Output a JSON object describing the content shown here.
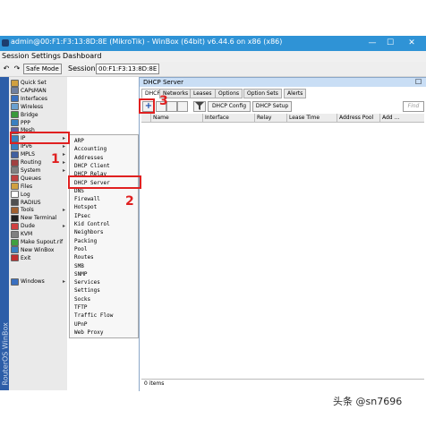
{
  "titlebar": {
    "title": "admin@00:F1:F3:13:8D:8E (MikroTik) - WinBox (64bit) v6.44.6 on x86 (x86)",
    "minimize": "—",
    "maximize": "☐",
    "close": "✕"
  },
  "menubar": {
    "items": [
      "Session",
      "Settings",
      "Dashboard"
    ]
  },
  "toolbar": {
    "back": "↶",
    "forward": "↷",
    "safe_mode_label": "Safe Mode",
    "session_label": "Session:",
    "session_value": "00:F1:F3:13:8D:8E"
  },
  "sidebar": {
    "brand": "RouterOS WinBox",
    "items": [
      {
        "label": "Quick Set",
        "color": "#d0a040"
      },
      {
        "label": "CAPsMAN",
        "color": "#7080a0"
      },
      {
        "label": "Interfaces",
        "color": "#3a70c0"
      },
      {
        "label": "Wireless",
        "color": "#6aa0d0"
      },
      {
        "label": "Bridge",
        "color": "#3a9a3a"
      },
      {
        "label": "PPP",
        "color": "#3a80c0"
      },
      {
        "label": "Mesh",
        "color": "#6060a0"
      },
      {
        "label": "IP",
        "color": "#3a80c0",
        "arrow": "▸"
      },
      {
        "label": "IPv6",
        "color": "#3a80c0",
        "arrow": "▸"
      },
      {
        "label": "MPLS",
        "color": "#4060a0",
        "arrow": "▸"
      },
      {
        "label": "Routing",
        "color": "#a04040",
        "arrow": "▸"
      },
      {
        "label": "System",
        "color": "#808080",
        "arrow": "▸"
      },
      {
        "label": "Queues",
        "color": "#c04040"
      },
      {
        "label": "Files",
        "color": "#d0a040"
      },
      {
        "label": "Log",
        "color": "#ffffff"
      },
      {
        "label": "RADIUS",
        "color": "#505050"
      },
      {
        "label": "Tools",
        "color": "#a06030",
        "arrow": "▸"
      },
      {
        "label": "New Terminal",
        "color": "#202020"
      },
      {
        "label": "Dude",
        "color": "#d04040",
        "arrow": "▸"
      },
      {
        "label": "KVM",
        "color": "#808080"
      },
      {
        "label": "Make Supout.rif",
        "color": "#40a040"
      },
      {
        "label": "New WinBox",
        "color": "#3a80c0"
      },
      {
        "label": "Exit",
        "color": "#c03030"
      },
      {
        "label": "Windows",
        "color": "#3a70c0",
        "arrow": "▸"
      }
    ]
  },
  "ip_submenu": {
    "items": [
      "ARP",
      "Accounting",
      "Addresses",
      "DHCP Client",
      "DHCP Relay",
      "DHCP Server",
      "DNS",
      "Firewall",
      "Hotspot",
      "IPsec",
      "Kid Control",
      "Neighbors",
      "Packing",
      "Pool",
      "Routes",
      "SMB",
      "SNMP",
      "Services",
      "Settings",
      "Socks",
      "TFTP",
      "Traffic Flow",
      "UPnP",
      "Web Proxy"
    ]
  },
  "dhcp_window": {
    "title": "DHCP Server",
    "tabs": [
      "DHCP",
      "Networks",
      "Leases",
      "Options",
      "Option Sets",
      "Alerts"
    ],
    "toolbar": {
      "add": "+",
      "filter_icon": "funnel",
      "dhcp_config": "DHCP Config",
      "dhcp_setup": "DHCP Setup",
      "find_placeholder": "Find"
    },
    "columns": [
      "Name",
      "Interface",
      "Relay",
      "Lease Time",
      "Address Pool",
      "Add ..."
    ],
    "status": "0 items"
  },
  "annotations": {
    "n1": "1",
    "n2": "2",
    "n3": "3",
    "accent": "#e02020"
  },
  "watermark": "头条 @sn7696"
}
